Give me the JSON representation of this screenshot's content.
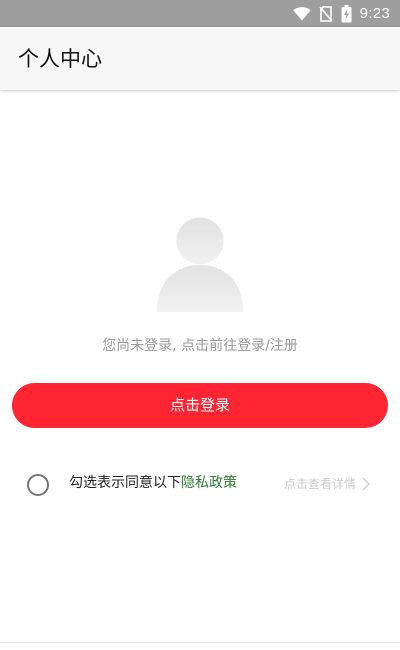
{
  "status_bar": {
    "time": "9:23",
    "icons": [
      "wifi-icon",
      "no-sim-icon",
      "battery-charging-icon"
    ]
  },
  "app_bar": {
    "title": "个人中心"
  },
  "profile": {
    "avatar_icon": "default-avatar-icon",
    "login_tip": "您尚未登录, 点击前往登录/注册",
    "login_button_label": "点击登录"
  },
  "agreement": {
    "checked": false,
    "prefix_text": "勾选表示同意以下",
    "privacy_link_text": "隐私政策",
    "detail_link_text": "点击查看详情",
    "detail_icon": "chevron-right-icon"
  },
  "colors": {
    "status_bar_bg": "#9e9e9e",
    "app_bar_bg": "#f7f7f7",
    "accent_red": "#ff2533",
    "privacy_link": "#2e7d32",
    "muted_text": "#999999",
    "detail_text": "#cccccc"
  }
}
